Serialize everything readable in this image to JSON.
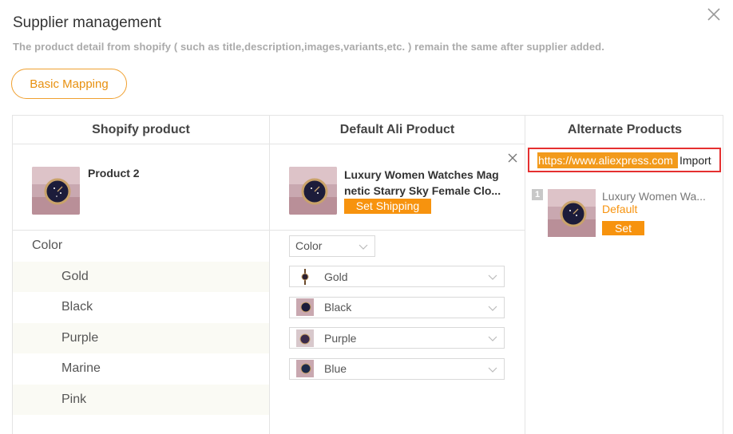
{
  "dialog": {
    "title": "Supplier management",
    "subtitle": "The product detail from shopify ( such as title,description,images,variants,etc. ) remain the same after supplier added.",
    "basic_mapping_label": "Basic Mapping"
  },
  "table": {
    "headers": [
      "Shopify product",
      "Default Ali Product",
      "Alternate Products"
    ],
    "shopify_product": {
      "name": "Product 2"
    },
    "ali_product": {
      "title": "Luxury Women Watches Mag netic Starry Sky Female Clo...",
      "set_shipping_label": "Set Shipping"
    },
    "option_group": "Color",
    "option_select_value": "Color",
    "variants": [
      {
        "shopify": "Gold",
        "ali": "Gold"
      },
      {
        "shopify": "Black",
        "ali": "Black"
      },
      {
        "shopify": "Purple",
        "ali": "Purple"
      },
      {
        "shopify": "Marine",
        "ali": "Blue"
      },
      {
        "shopify": "Pink",
        "ali": ""
      }
    ]
  },
  "alternate": {
    "url_value": "https://www.aliexpress.com",
    "import_label": "Import",
    "items": [
      {
        "index": "1",
        "title": "Luxury Women Wa...",
        "status": "Default",
        "set_label": "Set"
      }
    ]
  },
  "colors": {
    "accent": "#f7930e",
    "highlight_border": "#e53030"
  }
}
